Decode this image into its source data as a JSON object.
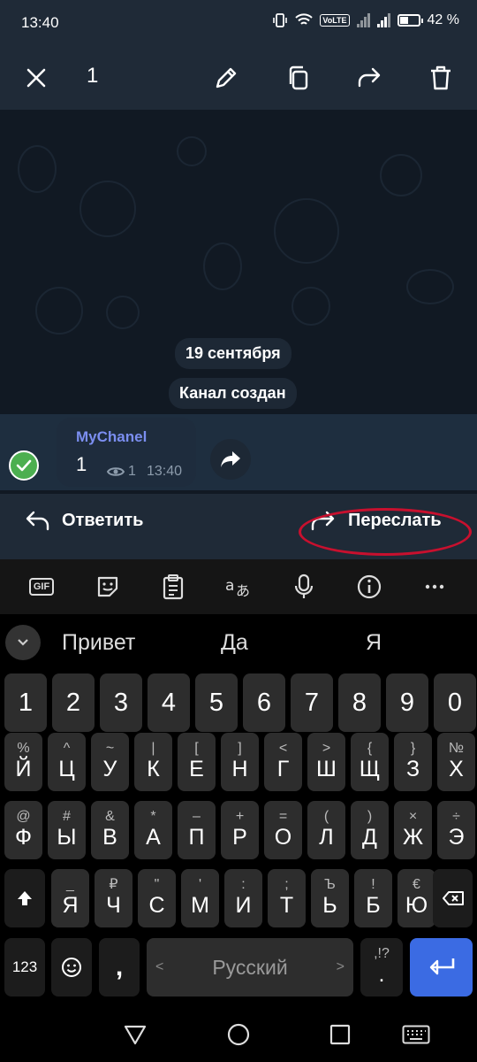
{
  "status_bar": {
    "time": "13:40",
    "volte": "VoLTE",
    "battery": "42 %"
  },
  "top_bar": {
    "selected_count": "1"
  },
  "chat": {
    "date_label": "19 сентября",
    "system_message": "Канал создан",
    "message": {
      "sender": "MyChanel",
      "text": "1",
      "views": "1",
      "time": "13:40"
    }
  },
  "actions": {
    "reply_label": "Ответить",
    "forward_label": "Переслать"
  },
  "keyboard": {
    "toolbar": [
      "gif",
      "sticker",
      "clipboard",
      "translate",
      "microphone",
      "info",
      "more"
    ],
    "gif_label": "GIF",
    "suggestions": [
      "Привет",
      "Да",
      "Я"
    ],
    "rows": [
      [
        {
          "main": "1"
        },
        {
          "main": "2"
        },
        {
          "main": "3"
        },
        {
          "main": "4"
        },
        {
          "main": "5"
        },
        {
          "main": "6"
        },
        {
          "main": "7"
        },
        {
          "main": "8"
        },
        {
          "main": "9"
        },
        {
          "main": "0"
        }
      ],
      [
        {
          "main": "Й",
          "sup": "%"
        },
        {
          "main": "Ц",
          "sup": "^"
        },
        {
          "main": "У",
          "sup": "~"
        },
        {
          "main": "К",
          "sup": "|"
        },
        {
          "main": "Е",
          "sup": "["
        },
        {
          "main": "Н",
          "sup": "]"
        },
        {
          "main": "Г",
          "sup": "<"
        },
        {
          "main": "Ш",
          "sup": ">"
        },
        {
          "main": "Щ",
          "sup": "{"
        },
        {
          "main": "З",
          "sup": "}"
        },
        {
          "main": "Х",
          "sup": "№"
        }
      ],
      [
        {
          "main": "Ф",
          "sup": "@"
        },
        {
          "main": "Ы",
          "sup": "#"
        },
        {
          "main": "В",
          "sup": "&"
        },
        {
          "main": "А",
          "sup": "*"
        },
        {
          "main": "П",
          "sup": "–"
        },
        {
          "main": "Р",
          "sup": "+"
        },
        {
          "main": "О",
          "sup": "="
        },
        {
          "main": "Л",
          "sup": "("
        },
        {
          "main": "Д",
          "sup": ")"
        },
        {
          "main": "Ж",
          "sup": "×"
        },
        {
          "main": "Э",
          "sup": "÷"
        }
      ],
      [
        {
          "main": "Я",
          "sup": "_"
        },
        {
          "main": "Ч",
          "sup": "₽"
        },
        {
          "main": "С",
          "sup": "\""
        },
        {
          "main": "М",
          "sup": "'"
        },
        {
          "main": "И",
          "sup": ":"
        },
        {
          "main": "Т",
          "sup": ";"
        },
        {
          "main": "Ь",
          "sup": "Ъ"
        },
        {
          "main": "Б",
          "sup": "!"
        },
        {
          "main": "Ю",
          "sup": "€"
        }
      ]
    ],
    "symbols_label": "123",
    "comma": ",",
    "space_label": "Русский",
    "space_left": "<",
    "space_right": ">",
    "period_sup": ",!?",
    "period": "."
  }
}
